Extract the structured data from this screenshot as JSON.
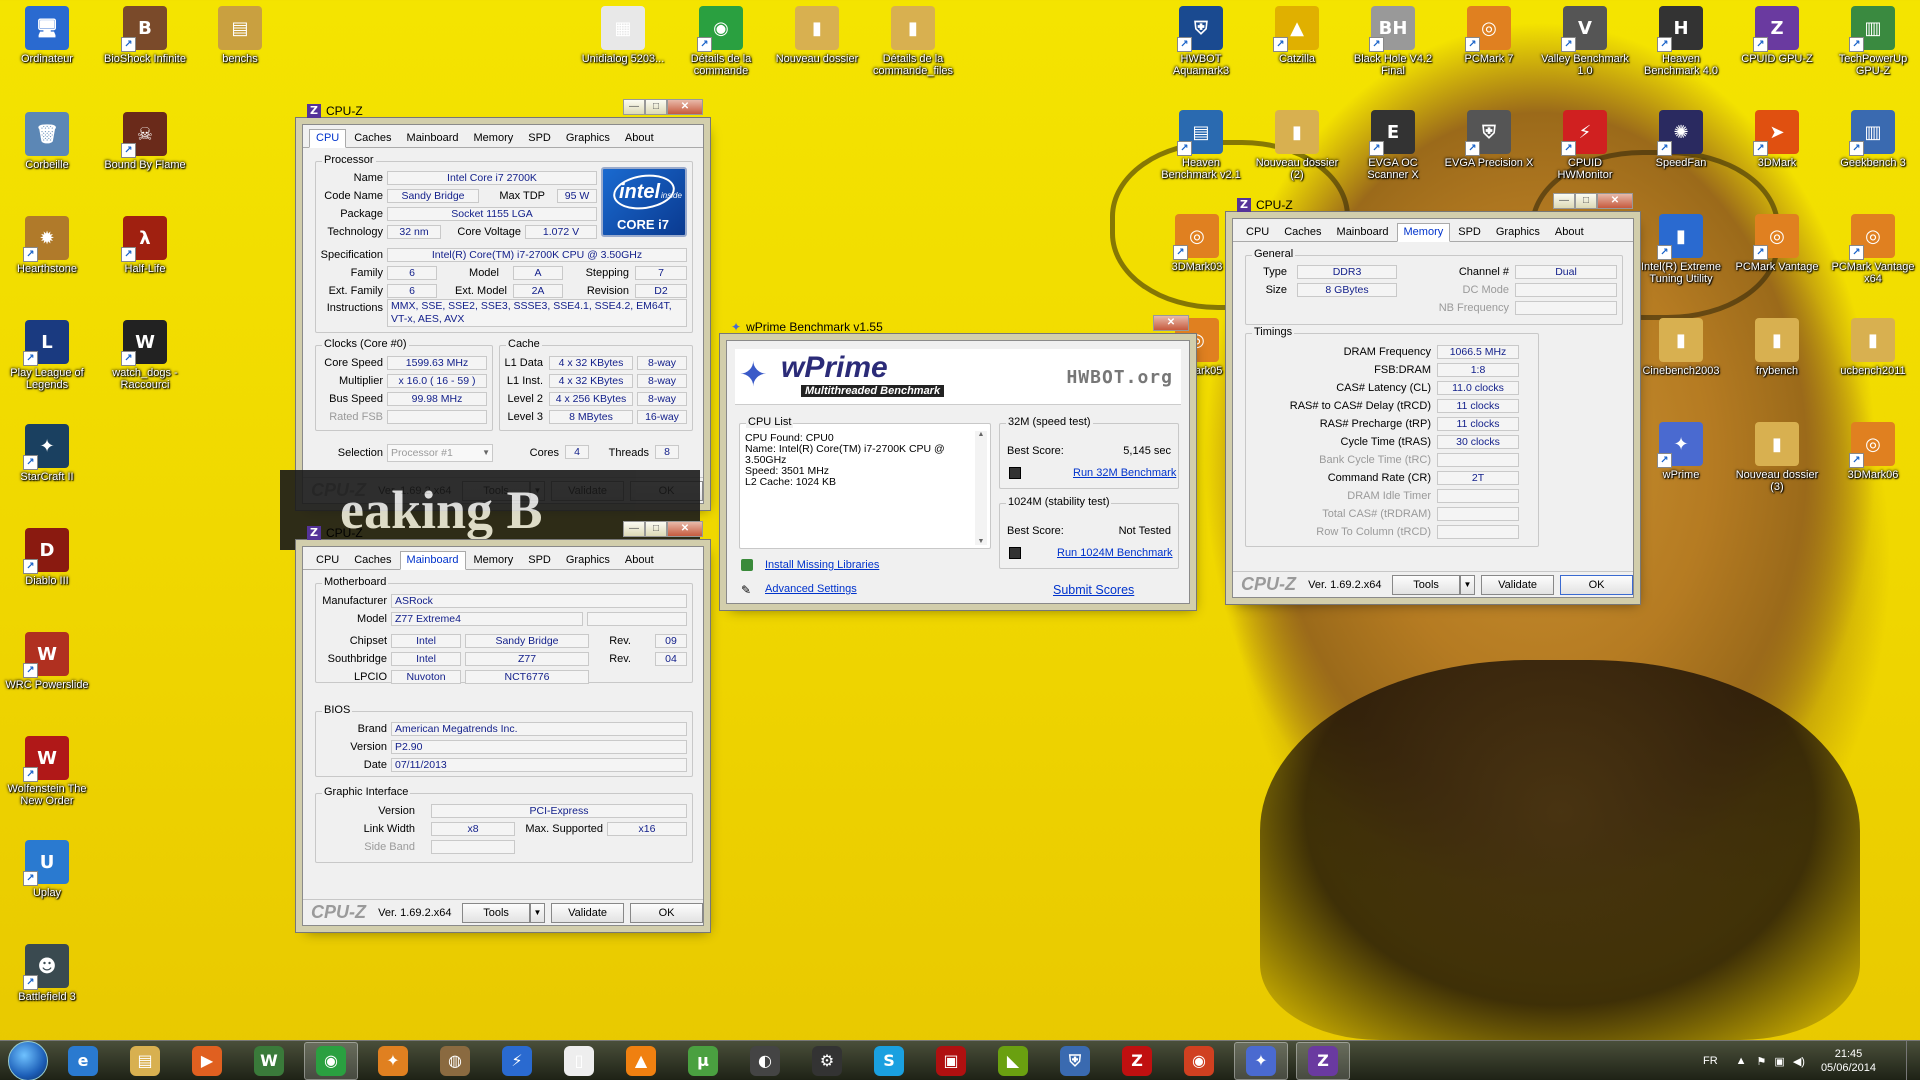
{
  "desktop": {
    "icons_left": [
      {
        "label": "Ordinateur",
        "glyph": "🖥",
        "color": "#2a6ad0",
        "link": false
      },
      {
        "label": "BioShock Infinite",
        "glyph": "B",
        "color": "#7a4a2a",
        "link": true
      },
      {
        "label": "benchs",
        "glyph": "▤",
        "color": "#c9a040",
        "link": false
      },
      {
        "label": "Corbeille",
        "glyph": "🗑",
        "color": "#5c87b5",
        "link": false
      },
      {
        "label": "Bound By Flame",
        "glyph": "☠",
        "color": "#6a2a1a",
        "link": true
      },
      {
        "label": "Hearthstone",
        "glyph": "✹",
        "color": "#b07a2a",
        "link": true
      },
      {
        "label": "Half-Life",
        "glyph": "λ",
        "color": "#a02010",
        "link": true
      },
      {
        "label": "Play League of Legends",
        "glyph": "L",
        "color": "#1a3a80",
        "link": true
      },
      {
        "label": "watch_dogs - Raccourci",
        "glyph": "W",
        "color": "#222",
        "link": true
      },
      {
        "label": "StarCraft II",
        "glyph": "✦",
        "color": "#1a4060",
        "link": true
      },
      {
        "label": "Diablo III",
        "glyph": "D",
        "color": "#8a1a10",
        "link": true
      },
      {
        "label": "WRC Powerslide",
        "glyph": "W",
        "color": "#b03020",
        "link": true
      },
      {
        "label": "Wolfenstein The New Order",
        "glyph": "W",
        "color": "#b01818",
        "link": true
      },
      {
        "label": "Uplay",
        "glyph": "U",
        "color": "#2a7ad0",
        "link": true
      },
      {
        "label": "Battlefield 3",
        "glyph": "☻",
        "color": "#3a4a50",
        "link": true
      }
    ],
    "icons_top": [
      {
        "label": "Unidialog 5203...",
        "glyph": "▦",
        "color": "#e8e8e8",
        "link": false
      },
      {
        "label": "Détails de la commande",
        "glyph": "◉",
        "color": "#2aa040",
        "link": true
      },
      {
        "label": "Nouveau dossier",
        "glyph": "▮",
        "color": "#d8b050",
        "link": false
      },
      {
        "label": "Détails de la commande_files",
        "glyph": "▮",
        "color": "#d8b050",
        "link": false
      }
    ],
    "icons_right": [
      {
        "label": "HWBOT Aquamark3",
        "glyph": "⛨",
        "color": "#1a4a90",
        "link": true
      },
      {
        "label": "Catzilla",
        "glyph": "▲",
        "color": "#e0b000",
        "link": true
      },
      {
        "label": "Black Hole V4.2 Final",
        "glyph": "BH",
        "color": "#999",
        "link": true
      },
      {
        "label": "PCMark 7",
        "glyph": "◎",
        "color": "#e08020",
        "link": true
      },
      {
        "label": "Valley Benchmark 1.0",
        "glyph": "V",
        "color": "#555",
        "link": true
      },
      {
        "label": "Heaven Benchmark 4.0",
        "glyph": "H",
        "color": "#333",
        "link": true
      },
      {
        "label": "CPUID GPU-Z",
        "glyph": "Z",
        "color": "#6a3aa0",
        "link": true
      },
      {
        "label": "TechPowerUp GPU-Z",
        "glyph": "▥",
        "color": "#3a8a40",
        "link": true
      },
      {
        "label": "Heaven Benchmark v2.1",
        "glyph": "▤",
        "color": "#2a6ab0",
        "link": true
      },
      {
        "label": "Nouveau dossier (2)",
        "glyph": "▮",
        "color": "#d8b050",
        "link": false
      },
      {
        "label": "EVGA OC Scanner X",
        "glyph": "E",
        "color": "#333",
        "link": true
      },
      {
        "label": "EVGA Precision X",
        "glyph": "⛨",
        "color": "#555",
        "link": true
      },
      {
        "label": "CPUID HWMonitor",
        "glyph": "⚡",
        "color": "#d02020",
        "link": true
      },
      {
        "label": "SpeedFan",
        "glyph": "✺",
        "color": "#2a2a60",
        "link": true
      },
      {
        "label": "3DMark",
        "glyph": "➤",
        "color": "#e05010",
        "link": true
      },
      {
        "label": "Geekbench 3",
        "glyph": "▥",
        "color": "#3a6ab0",
        "link": true
      },
      {
        "label": "3DMark03",
        "glyph": "◎",
        "color": "#e08020",
        "link": true
      },
      {
        "label": "3DMark05",
        "glyph": "◎",
        "color": "#e08020",
        "link": true
      },
      {
        "label": "Intel(R) Extreme Tuning Utility",
        "glyph": "▮",
        "color": "#2a6ad0",
        "link": true
      },
      {
        "label": "PCMark Vantage",
        "glyph": "◎",
        "color": "#e08020",
        "link": true
      },
      {
        "label": "PCMark Vantage x64",
        "glyph": "◎",
        "color": "#e08020",
        "link": true
      },
      {
        "label": "Cinebench2003",
        "glyph": "▮",
        "color": "#d8b050",
        "link": false
      },
      {
        "label": "frybench",
        "glyph": "▮",
        "color": "#d8b050",
        "link": false
      },
      {
        "label": "ucbench2011",
        "glyph": "▮",
        "color": "#d8b050",
        "link": false
      },
      {
        "label": "wPrime",
        "glyph": "✦",
        "color": "#4a6ad0",
        "link": true
      },
      {
        "label": "Nouveau dossier (3)",
        "glyph": "▮",
        "color": "#d8b050",
        "link": false
      },
      {
        "label": "3DMark06",
        "glyph": "◎",
        "color": "#e08020",
        "link": true
      }
    ]
  },
  "cpuz_cpu": {
    "title": "CPU-Z",
    "tabs": [
      "CPU",
      "Caches",
      "Mainboard",
      "Memory",
      "SPD",
      "Graphics",
      "About"
    ],
    "processor_label": "Processor",
    "name_label": "Name",
    "name": "Intel Core i7 2700K",
    "codename_label": "Code Name",
    "codename": "Sandy Bridge",
    "maxtdp_label": "Max TDP",
    "maxtdp": "95 W",
    "package_label": "Package",
    "package": "Socket 1155 LGA",
    "tech_label": "Technology",
    "tech": "32 nm",
    "voltage_label": "Core Voltage",
    "voltage": "1.072 V",
    "spec_label": "Specification",
    "spec": "Intel(R) Core(TM) i7-2700K CPU @ 3.50GHz",
    "family_label": "Family",
    "family": "6",
    "model_label": "Model",
    "model": "A",
    "stepping_label": "Stepping",
    "stepping": "7",
    "extfamily_label": "Ext. Family",
    "extfamily": "6",
    "extmodel_label": "Ext. Model",
    "extmodel": "2A",
    "revision_label": "Revision",
    "revision": "D2",
    "instr_label": "Instructions",
    "instr": "MMX, SSE, SSE2, SSE3, SSSE3, SSE4.1, SSE4.2, EM64T, VT-x, AES, AVX",
    "clocks_label": "Clocks (Core #0)",
    "corespeed_label": "Core Speed",
    "corespeed": "1599.63 MHz",
    "multiplier_label": "Multiplier",
    "multiplier": "x 16.0 ( 16 - 59 )",
    "busspeed_label": "Bus Speed",
    "busspeed": "99.98 MHz",
    "ratedfsb_label": "Rated FSB",
    "ratedfsb": "",
    "cache_label": "Cache",
    "l1d_label": "L1 Data",
    "l1d": "4 x 32 KBytes",
    "l1d_way": "8-way",
    "l1i_label": "L1 Inst.",
    "l1i": "4 x 32 KBytes",
    "l1i_way": "8-way",
    "l2_label": "Level 2",
    "l2": "4 x 256 KBytes",
    "l2_way": "8-way",
    "l3_label": "Level 3",
    "l3": "8 MBytes",
    "l3_way": "16-way",
    "selection_label": "Selection",
    "selection": "Processor #1",
    "cores_label": "Cores",
    "cores": "4",
    "threads_label": "Threads",
    "threads": "8",
    "intel_badge_top": "intel",
    "intel_badge_inside": "inside",
    "intel_badge_bottom": "CORE i7"
  },
  "cpuz_mb": {
    "title": "CPU-Z",
    "motherboard_label": "Motherboard",
    "manufacturer_label": "Manufacturer",
    "manufacturer": "ASRock",
    "model_label": "Model",
    "model": "Z77 Extreme4",
    "chipset_label": "Chipset",
    "chipset_vendor": "Intel",
    "chipset_name": "Sandy Bridge",
    "chipset_rev_label": "Rev.",
    "chipset_rev": "09",
    "southbridge_label": "Southbridge",
    "sb_vendor": "Intel",
    "sb_name": "Z77",
    "sb_rev_label": "Rev.",
    "sb_rev": "04",
    "lpcio_label": "LPCIO",
    "lpcio_vendor": "Nuvoton",
    "lpcio_name": "NCT6776",
    "bios_label": "BIOS",
    "brand_label": "Brand",
    "brand": "American Megatrends Inc.",
    "version_label": "Version",
    "version": "P2.90",
    "date_label": "Date",
    "date": "07/11/2013",
    "gi_label": "Graphic Interface",
    "giversion_label": "Version",
    "giversion": "PCI-Express",
    "linkwidth_label": "Link Width",
    "linkwidth": "x8",
    "maxsupported_label": "Max. Supported",
    "maxsupported": "x16",
    "sideband_label": "Side Band"
  },
  "cpuz_mem": {
    "title": "CPU-Z",
    "general_label": "General",
    "type_label": "Type",
    "type": "DDR3",
    "channel_label": "Channel #",
    "channel": "Dual",
    "size_label": "Size",
    "size": "8 GBytes",
    "dcmode_label": "DC Mode",
    "nbfreq_label": "NB Frequency",
    "timings_label": "Timings",
    "dramfreq_label": "DRAM Frequency",
    "dramfreq": "1066.5 MHz",
    "fsbdram_label": "FSB:DRAM",
    "fsbdram": "1:8",
    "cas_label": "CAS# Latency (CL)",
    "cas": "11.0 clocks",
    "rcd_label": "RAS# to CAS# Delay (tRCD)",
    "rcd": "11 clocks",
    "rp_label": "RAS# Precharge (tRP)",
    "rp": "11 clocks",
    "ras_label": "Cycle Time (tRAS)",
    "ras": "30 clocks",
    "rc_label": "Bank Cycle Time (tRC)",
    "cr_label": "Command Rate (CR)",
    "cr": "2T",
    "idle_label": "DRAM Idle Timer",
    "totalcas_label": "Total CAS# (tRDRAM)",
    "rtc_label": "Row To Column (tRCD)"
  },
  "footer": {
    "logo": "CPU-Z",
    "version": "Ver. 1.69.2.x64",
    "tools": "Tools",
    "validate": "Validate",
    "ok": "OK"
  },
  "wprime": {
    "title": "wPrime Benchmark v1.55",
    "logo": "wPrime",
    "subtitle": "Multithreaded Benchmark",
    "hwbot": "HWBOT.org",
    "cpulist_label": "CPU List",
    "cpulist": [
      "CPU Found: CPU0",
      "Name:   Intel(R) Core(TM) i7-2700K CPU @",
      "3.50GHz",
      "Speed:   3501 MHz",
      "L2 Cache: 1024 KB"
    ],
    "t32_label": "32M (speed test)",
    "t32_best_label": "Best Score:",
    "t32_best": "5,145 sec",
    "t32_run": "Run 32M Benchmark",
    "t1024_label": "1024M (stability test)",
    "t1024_best_label": "Best Score:",
    "t1024_best": "Not Tested",
    "t1024_run": "Run 1024M Benchmark",
    "install": "Install Missing Libraries",
    "advanced": "Advanced Settings",
    "submit": "Submit Scores"
  },
  "taskbar": {
    "lang": "FR",
    "time": "21:45",
    "date": "05/06/2014",
    "apps": [
      {
        "name": "ie",
        "glyph": "e",
        "color": "#2a7ad0",
        "active": false
      },
      {
        "name": "explorer",
        "glyph": "▤",
        "color": "#d8b050",
        "active": false
      },
      {
        "name": "media",
        "glyph": "▶",
        "color": "#e06020",
        "active": false
      },
      {
        "name": "watchdogs",
        "glyph": "W",
        "color": "#3a7a3a",
        "active": false
      },
      {
        "name": "chrome",
        "glyph": "◉",
        "color": "#2aa040",
        "active": true
      },
      {
        "name": "app6",
        "glyph": "✦",
        "color": "#e08020",
        "active": false
      },
      {
        "name": "app7",
        "glyph": "◍",
        "color": "#8a6a40",
        "active": false
      },
      {
        "name": "app8",
        "glyph": "⚡",
        "color": "#2a6ad0",
        "active": false
      },
      {
        "name": "notepad",
        "glyph": "▯",
        "color": "#eee",
        "active": false
      },
      {
        "name": "vlc",
        "glyph": "▲",
        "color": "#f08010",
        "active": false
      },
      {
        "name": "utorrent",
        "glyph": "µ",
        "color": "#4aa040",
        "active": false
      },
      {
        "name": "app12",
        "glyph": "◐",
        "color": "#444",
        "active": false
      },
      {
        "name": "steam",
        "glyph": "⚙",
        "color": "#333",
        "active": false
      },
      {
        "name": "skype",
        "glyph": "S",
        "color": "#1aa0e0",
        "active": false
      },
      {
        "name": "app15",
        "glyph": "▣",
        "color": "#b01010",
        "active": false
      },
      {
        "name": "nvidia",
        "glyph": "◣",
        "color": "#6aa010",
        "active": false
      },
      {
        "name": "app17",
        "glyph": "⛨",
        "color": "#3a6ab0",
        "active": false
      },
      {
        "name": "filezilla",
        "glyph": "Z",
        "color": "#c01010",
        "active": false
      },
      {
        "name": "app19",
        "glyph": "◉",
        "color": "#d04020",
        "active": false
      },
      {
        "name": "wprime",
        "glyph": "✦",
        "color": "#4a6ad0",
        "active": true
      },
      {
        "name": "cpuz",
        "glyph": "Z",
        "color": "#6a3aa0",
        "active": true
      }
    ]
  }
}
